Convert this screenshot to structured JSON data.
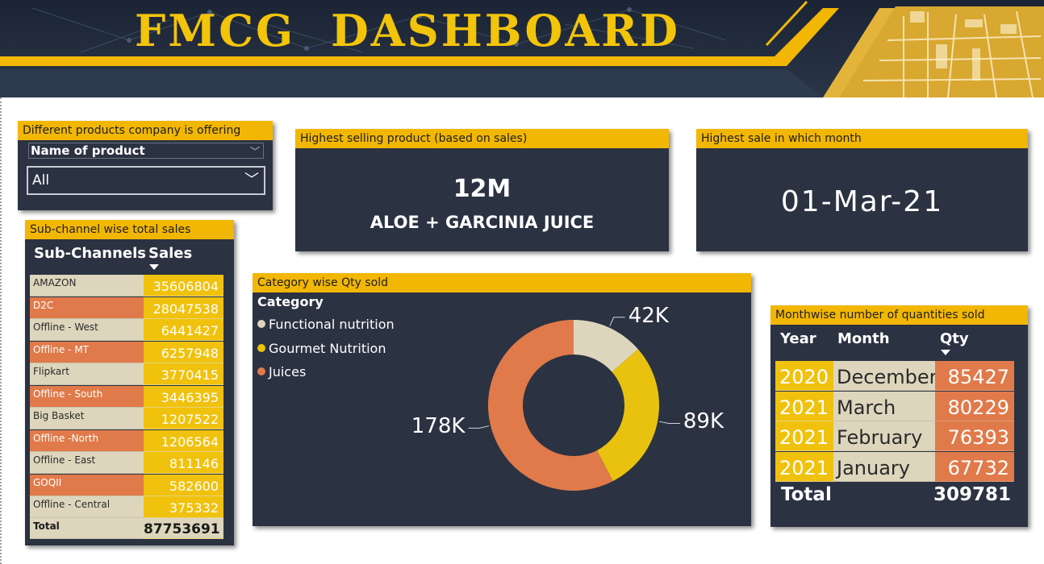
{
  "banner": {
    "title": "FMCG DASHBOARD"
  },
  "slicer": {
    "header": "Different products company is offering",
    "field_label": "Name of product",
    "selected": "All"
  },
  "kpi_product": {
    "header": "Highest selling product (based on sales)",
    "value": "12M",
    "product": "ALOE + GARCINIA JUICE"
  },
  "kpi_month": {
    "header": "Highest sale in which month",
    "value": "01-Mar-21"
  },
  "subchannel": {
    "header": "Sub-channel wise total sales",
    "col_channel": "Sub-Channels",
    "col_sales": "Sales",
    "rows": [
      {
        "name": "AMAZON",
        "sales": "35606804",
        "style": "light"
      },
      {
        "name": "D2C",
        "sales": "28047538",
        "style": "orange"
      },
      {
        "name": "Offline - West",
        "sales": "6441427",
        "style": "light"
      },
      {
        "name": "Offline - MT",
        "sales": "6257948",
        "style": "orange"
      },
      {
        "name": "Flipkart",
        "sales": "3770415",
        "style": "light"
      },
      {
        "name": "Offline - South",
        "sales": "3446395",
        "style": "orange"
      },
      {
        "name": "Big Basket",
        "sales": "1207522",
        "style": "light"
      },
      {
        "name": "Offline -North",
        "sales": "1206564",
        "style": "orange"
      },
      {
        "name": "Offline - East",
        "sales": "811146",
        "style": "light"
      },
      {
        "name": "GOQII",
        "sales": "582600",
        "style": "orange"
      },
      {
        "name": "Offline - Central",
        "sales": "375332",
        "style": "light"
      }
    ],
    "total_label": "Total",
    "total_value": "87753691"
  },
  "category": {
    "header": "Category wise Qty sold",
    "legend_title": "Category",
    "legend": [
      {
        "name": "Functional nutrition",
        "color": "#ddd6bd"
      },
      {
        "name": "Gourmet Nutrition",
        "color": "#e8c20e"
      },
      {
        "name": "Juices",
        "color": "#e07a4a"
      }
    ]
  },
  "chart_data": {
    "type": "pie",
    "donut": true,
    "title": "Category wise Qty sold",
    "legend_title": "Category",
    "legend_position": "top-left",
    "categories": [
      "Functional nutrition",
      "Gourmet Nutrition",
      "Juices"
    ],
    "values": [
      42000,
      89000,
      178000
    ],
    "data_labels": [
      "42K",
      "89K",
      "178K"
    ],
    "colors": [
      "#ddd6bd",
      "#e8c20e",
      "#e07a4a"
    ]
  },
  "monthwise": {
    "header": "Monthwise number of quantities sold",
    "col_year": "Year",
    "col_month": "Month",
    "col_qty": "Qty",
    "rows": [
      {
        "year": "2020",
        "month": "December",
        "qty": "85427"
      },
      {
        "year": "2021",
        "month": "March",
        "qty": "80229"
      },
      {
        "year": "2021",
        "month": "February",
        "qty": "76393"
      },
      {
        "year": "2021",
        "month": "January",
        "qty": "67732"
      }
    ],
    "total_label": "Total",
    "total_value": "309781"
  }
}
